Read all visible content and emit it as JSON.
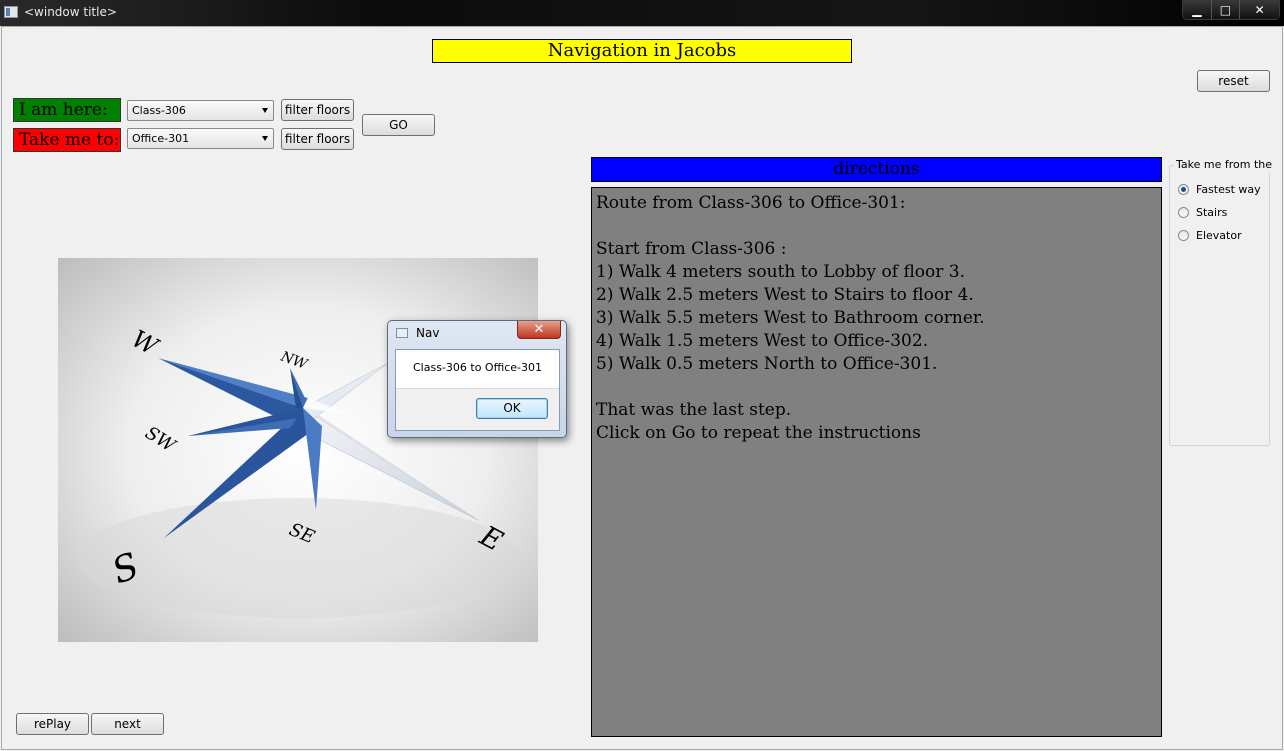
{
  "window": {
    "title": "<window title>",
    "controls": {
      "minimize": "▁",
      "maximize": "□",
      "close": "✕"
    }
  },
  "header": {
    "title": "Navigation in Jacobs"
  },
  "toolbar": {
    "reset_label": "reset",
    "go_label": "GO",
    "filter_label": "filter floors",
    "here_label": "I am here:",
    "to_label": "Take me to:",
    "here_value": "Class-306",
    "to_value": "Office-301"
  },
  "compass": {
    "labels": {
      "w": "W",
      "nw": "NW",
      "sw": "SW",
      "s": "S",
      "se": "SE",
      "e": "E"
    }
  },
  "directions": {
    "header": "directions",
    "text": "Route from Class-306 to Office-301:\n\nStart from Class-306 :\n1) Walk 4 meters south to Lobby of floor 3.\n2) Walk 2.5 meters West to Stairs to floor 4.\n3) Walk 5.5 meters West to Bathroom corner.\n4) Walk 1.5 meters West to Office-302.\n5) Walk 0.5 meters North to Office-301.\n\nThat was the last step.\nClick on Go to repeat the instructions"
  },
  "route_options": {
    "title": "Take me from the",
    "options": [
      {
        "label": "Fastest way",
        "selected": true
      },
      {
        "label": "Stairs",
        "selected": false
      },
      {
        "label": "Elevator",
        "selected": false
      }
    ]
  },
  "footer": {
    "replay_label": "rePlay",
    "next_label": "next"
  },
  "dialog": {
    "title": "Nav",
    "message": "Class-306 to Office-301",
    "ok_label": "OK",
    "close_glyph": "✕"
  },
  "colors": {
    "here_bg": "#008000",
    "to_bg": "#ff0000",
    "heading_bg": "#ffff00",
    "directions_header_bg": "#0000ff",
    "directions_body_bg": "#808080",
    "compass_blue": "#2f5fa8"
  }
}
